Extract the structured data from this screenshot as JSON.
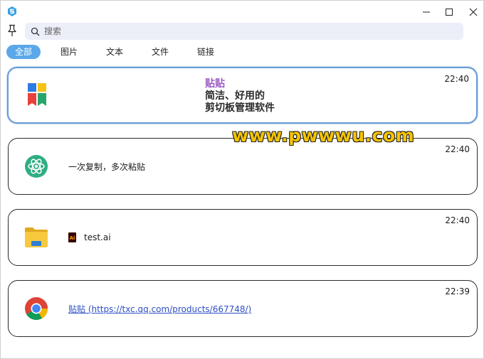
{
  "window": {
    "icons": {
      "logo": "app-logo-icon",
      "minimize": "minimize-icon",
      "maximize": "maximize-icon",
      "close": "close-icon",
      "pin": "pin-icon",
      "search": "search-icon"
    }
  },
  "search": {
    "placeholder": "搜索",
    "value": ""
  },
  "tabs": [
    {
      "label": "全部",
      "active": true
    },
    {
      "label": "图片",
      "active": false
    },
    {
      "label": "文本",
      "active": false
    },
    {
      "label": "文件",
      "active": false
    },
    {
      "label": "链接",
      "active": false
    }
  ],
  "items": [
    {
      "time": "22:40",
      "icon": "app-logo-icon",
      "promo": [
        "贴贴",
        "简洁、好用的",
        "剪切板管理软件"
      ],
      "selected": true
    },
    {
      "time": "22:40",
      "icon": "atom-icon",
      "text": "一次复制，多次粘贴"
    },
    {
      "time": "22:40",
      "icon": "folder-icon",
      "file_icon": "illustrator-file-icon",
      "text": "test.ai"
    },
    {
      "time": "22:39",
      "icon": "chrome-icon",
      "link": "贴贴 (https://txc.qq.com/products/667748/)"
    }
  ],
  "watermark": "www.pwwwu.com",
  "colors": {
    "accent": "#5ba8e8",
    "promo_purple": "#9b59c5",
    "link": "#2d4fc4",
    "selected_border": "#6b9bd6",
    "search_bg": "#eceef8",
    "watermark": "#f4c400"
  }
}
